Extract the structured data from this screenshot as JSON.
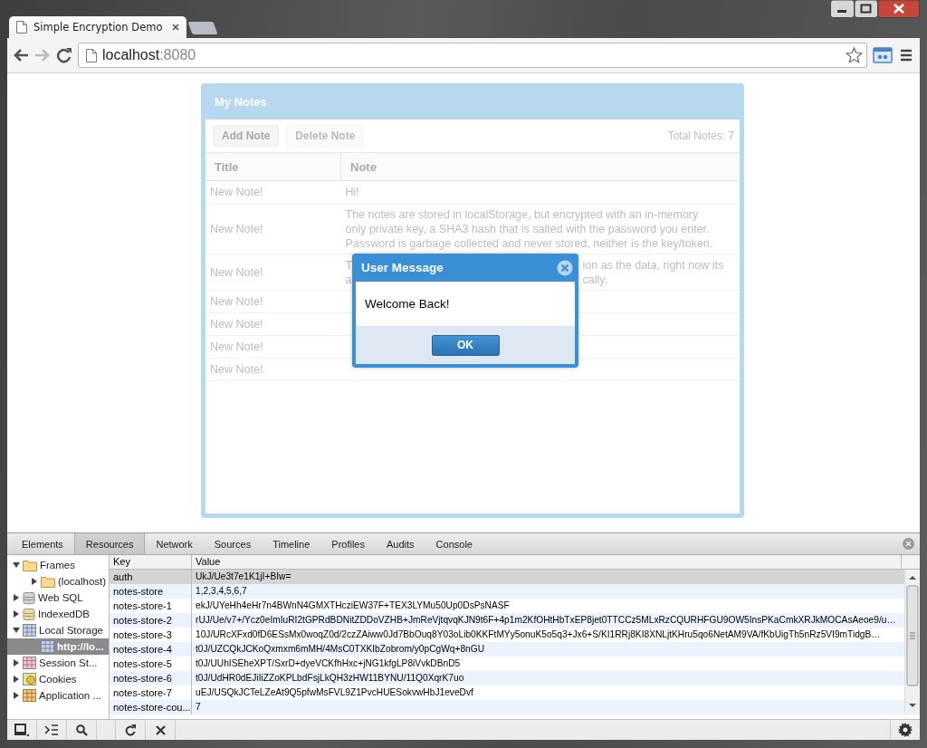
{
  "browser": {
    "tabs": [
      {
        "title": "Simple Encryption Demo",
        "selected": true
      }
    ],
    "address": {
      "host": "localhost",
      "port": ":8080"
    }
  },
  "page": {
    "panel_title": "My Notes",
    "toolbar": {
      "buttons": [
        {
          "label": "Add Note",
          "disabled": false
        },
        {
          "label": "Delete Note",
          "disabled": true
        }
      ],
      "total": "Total Notes: 7"
    },
    "table": {
      "columns": [
        "Title",
        "Note"
      ],
      "rows": [
        {
          "title": "New Note!",
          "note": [
            [
              "Hi!"
            ]
          ]
        },
        {
          "title": "New Note!",
          "note": [
            [
              "The notes are stored in localStorage, but encrypted with an in-memory"
            ],
            [
              "only private key, a SHA3 hash that is salted with the password you enter."
            ],
            [
              "Password is garbage collected and never stored, neither is the key/token."
            ]
          ]
        },
        {
          "title": "New Note!",
          "note": [
            [
              "T",
              "ion as the data, right now its"
            ],
            [
              "a",
              "cally."
            ]
          ]
        },
        {
          "title": "New Note!",
          "note": []
        },
        {
          "title": "New Note!",
          "note": []
        },
        {
          "title": "New Note!",
          "note": []
        },
        {
          "title": "New Note!",
          "note": []
        }
      ]
    }
  },
  "dialog": {
    "title": "User Message",
    "message": "Welcome Back!",
    "button": "OK"
  },
  "devtools": {
    "tabs": [
      {
        "label": "Elements",
        "selected": false
      },
      {
        "label": "Resources",
        "selected": true
      },
      {
        "label": "Network",
        "selected": false
      },
      {
        "label": "Sources",
        "selected": false
      },
      {
        "label": "Timeline",
        "selected": false
      },
      {
        "label": "Profiles",
        "selected": false
      },
      {
        "label": "Audits",
        "selected": false
      },
      {
        "label": "Console",
        "selected": false
      }
    ],
    "tree": [
      {
        "label": "Frames",
        "kind": "folder",
        "expanded": true,
        "selected": false,
        "children": [
          {
            "label": "(localhost)",
            "kind": "folder",
            "expanded": false,
            "selected": false
          }
        ]
      },
      {
        "label": "Web SQL",
        "kind": "database",
        "expanded": false,
        "selected": false
      },
      {
        "label": "IndexedDB",
        "kind": "indexeddb",
        "expanded": false,
        "selected": false
      },
      {
        "label": "Local Storage",
        "kind": "storage",
        "expanded": true,
        "selected": false,
        "children": [
          {
            "label": "http://lo...",
            "kind": "storage",
            "selected": true
          }
        ]
      },
      {
        "label": "Session St...",
        "kind": "session",
        "expanded": false,
        "selected": false
      },
      {
        "label": "Cookies",
        "kind": "cookie",
        "expanded": false,
        "selected": false
      },
      {
        "label": "Application ...",
        "kind": "cache",
        "expanded": false,
        "selected": false
      }
    ],
    "table": {
      "columns": [
        "Key",
        "Value"
      ],
      "rows": [
        {
          "key": "auth",
          "value": "UkJ/Ue3t7e1K1jI+BIw=",
          "selected": true
        },
        {
          "key": "notes-store",
          "value": "1,2,3,4,5,6,7",
          "selected": false
        },
        {
          "key": "notes-store-1",
          "value": "ekJ/UYeHh4eHr7n4BWnN4GMXTHcziEW37F+TEX3LYMu50Up0DsPsNASF",
          "selected": false
        },
        {
          "key": "notes-store-2",
          "value": "rUJ/Ue/v7+/Ycz0eImIuRI2tGPRdBDNitZDDoVZHB+JmReVjtqvqKJN9t6F+4p1m2KfOHtHbTxEP8jet0TTCCz5MLxRzCQURHFGU9OW5InsPKaCmkXRJkMOCAsAeoe9/u…",
          "selected": false
        },
        {
          "key": "notes-store-3",
          "value": "10J/URcXFxd0fD6ESsMx0woqZ0d/2czZAiww0Jd7BbOuq8Y03oLib0KKFtMYy5onuK5o5q3+Jx6+S/KI1RRj8KI8XNLjtKHru5qo6NetAM9VA/fKbUigTh5nRz5VI9mTidgB…",
          "selected": false
        },
        {
          "key": "notes-store-4",
          "value": "t0J/UZCQkJCKoQxmxm6mMH/4MsC0TXKIbZobrom/y0pCgWq+8nGU",
          "selected": false
        },
        {
          "key": "notes-store-5",
          "value": "t0J/UUhISEheXPT/SxrD+dyeVCKfhHxc+jNG1kfgLP8iVvkDBnD5",
          "selected": false
        },
        {
          "key": "notes-store-6",
          "value": "t0J/UdHR0dEJiIiZZoKPLbdFsjLkQH3zHW11BYNU/11Q0XqrK7uo",
          "selected": false
        },
        {
          "key": "notes-store-7",
          "value": "uEJ/USQkJCTeLZeAt9Q5pfwMsFVL9Z1PvcHUESokvwHbJ1eveDvf",
          "selected": false
        },
        {
          "key": "notes-store-cou...",
          "value": "7",
          "selected": false
        }
      ]
    }
  }
}
